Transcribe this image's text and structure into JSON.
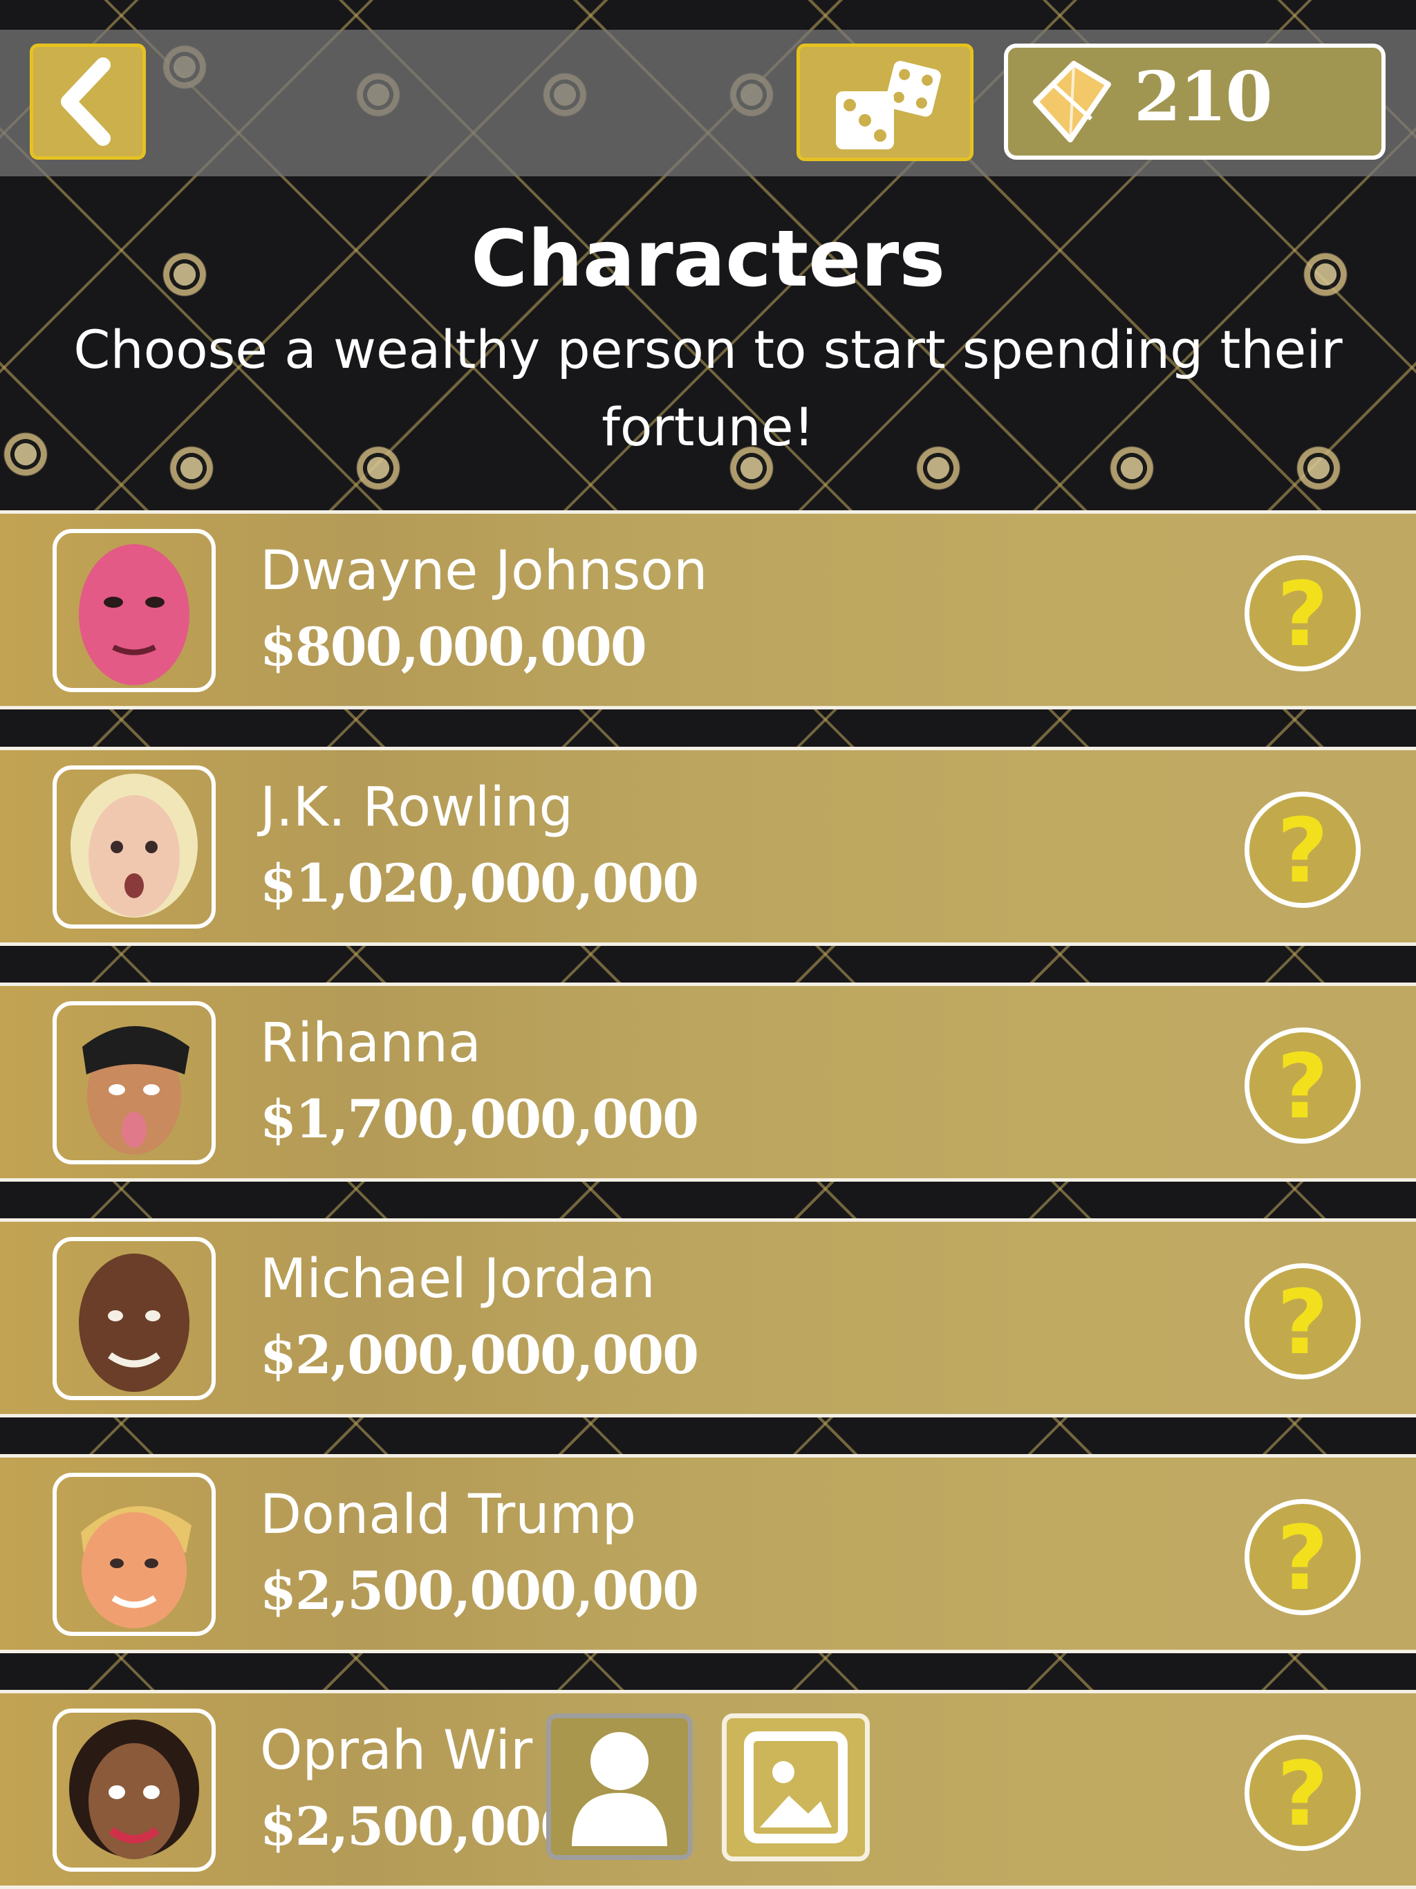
{
  "toolbar": {
    "gem_count": "210"
  },
  "header": {
    "title": "Characters",
    "subtitle": "Choose a wealthy person to start spending their fortune!"
  },
  "characters": [
    {
      "name": "Dwayne Johnson",
      "fortune": "$800,000,000",
      "face_color": "#e35a86"
    },
    {
      "name": "J.K. Rowling",
      "fortune": "$1,020,000,000",
      "face_color": "#f0c8b0"
    },
    {
      "name": "Rihanna",
      "fortune": "$1,700,000,000",
      "face_color": "#c98a5e"
    },
    {
      "name": "Michael Jordan",
      "fortune": "$2,000,000,000",
      "face_color": "#6a3e28"
    },
    {
      "name": "Donald Trump",
      "fortune": "$2,500,000,000",
      "face_color": "#f0a070"
    },
    {
      "name": "Oprah Wir",
      "fortune": "$2,500,000",
      "face_color": "#8a5a3a"
    }
  ],
  "help_label": "?",
  "colors": {
    "gold_accent": "#e5c220",
    "row_gold": "#bca65f",
    "background": "#17171a"
  }
}
